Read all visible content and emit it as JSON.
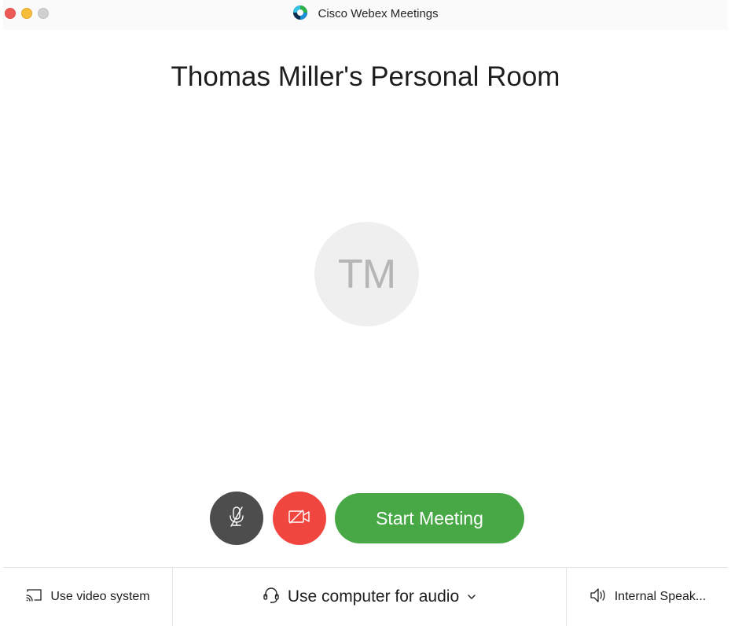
{
  "window": {
    "title": "Cisco Webex Meetings",
    "app_icon": "webex-logo-icon",
    "controls": [
      "close",
      "minimize",
      "zoom"
    ]
  },
  "room": {
    "title": "Thomas Miller's Personal Room",
    "avatar_initials": "TM"
  },
  "controls": {
    "mute_icon": "microphone-muted-icon",
    "video_icon": "video-off-icon",
    "start_label": "Start Meeting"
  },
  "bottom_bar": {
    "video_system_label": "Use video system",
    "video_system_icon": "cast-icon",
    "audio_label": "Use computer for audio",
    "audio_icon": "headset-icon",
    "audio_dropdown_icon": "chevron-down-icon",
    "speaker_label": "Internal Speak...",
    "speaker_icon": "speaker-icon"
  },
  "colors": {
    "start_button": "#48a846",
    "video_off_button": "#f0463f",
    "mute_button": "#4d4d4d",
    "avatar_bg": "#efefef",
    "traffic_close": "#ee5b56",
    "traffic_minimize": "#f6bd3b",
    "traffic_zoom": "#d0d0d0"
  }
}
